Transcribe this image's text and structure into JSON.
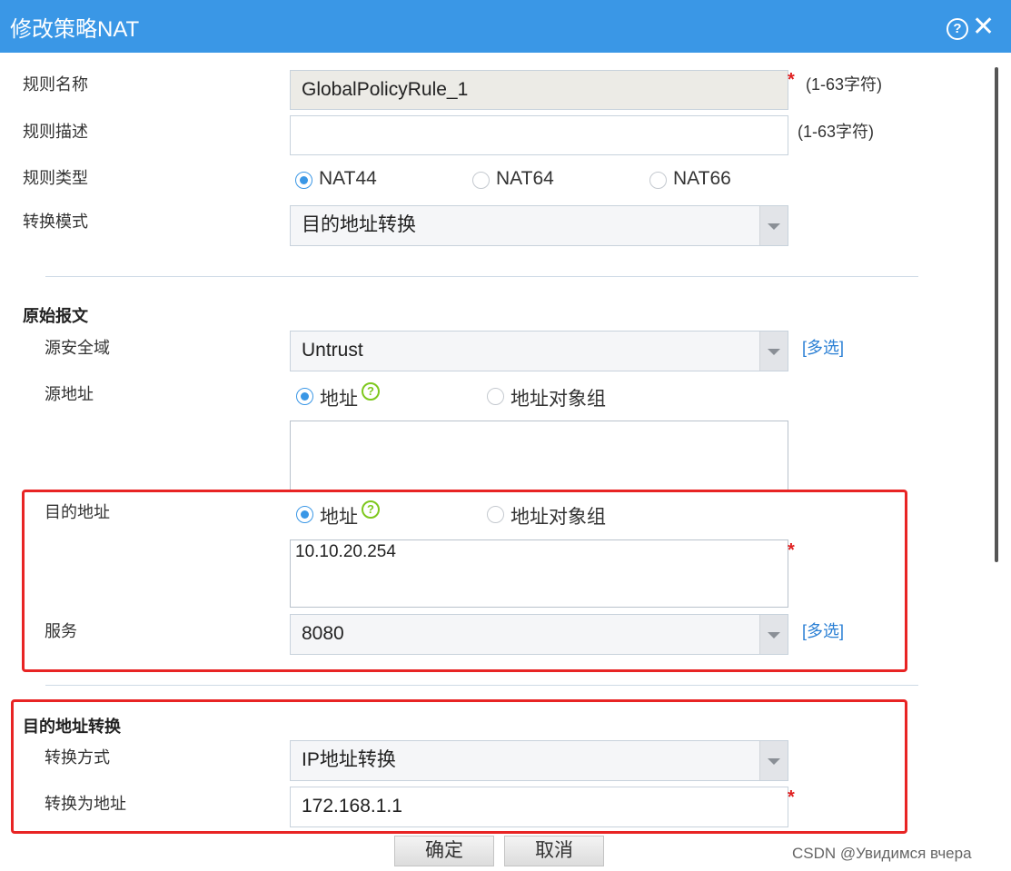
{
  "dialog": {
    "title": "修改策略NAT",
    "help_symbol": "?",
    "close_symbol": "✕"
  },
  "rule_name": {
    "label": "规则名称",
    "value": "GlobalPolicyRule_1",
    "required": "*",
    "hint": "(1-63字符)"
  },
  "rule_desc": {
    "label": "规则描述",
    "value": "",
    "hint": "(1-63字符)"
  },
  "rule_type": {
    "label": "规则类型",
    "options": [
      "NAT44",
      "NAT64",
      "NAT66"
    ],
    "selected": "NAT44"
  },
  "convert_mode": {
    "label": "转换模式",
    "value": "目的地址转换"
  },
  "original_packet": {
    "section_title": "原始报文",
    "src_zone": {
      "label": "源安全域",
      "value": "Untrust",
      "link": "[多选]"
    },
    "src_addr": {
      "label": "源地址",
      "option_addr": "地址",
      "option_group": "地址对象组",
      "value": ""
    },
    "dst_addr": {
      "label": "目的地址",
      "option_addr": "地址",
      "option_group": "地址对象组",
      "value": "10.10.20.254",
      "required": "*"
    },
    "service": {
      "label": "服务",
      "value": "8080",
      "link": "[多选]"
    }
  },
  "dst_translation": {
    "section_title": "目的地址转换",
    "method": {
      "label": "转换方式",
      "value": "IP地址转换"
    },
    "to_addr": {
      "label": "转换为地址",
      "value": "172.168.1.1",
      "required": "*"
    }
  },
  "buttons": {
    "ok": "确定",
    "cancel": "取消"
  },
  "watermark": "CSDN @Увидимся вчера",
  "colors": {
    "titlebar": "#3a97e6",
    "highlight_border": "#e82424",
    "link": "#2a7fd4",
    "required": "#e02020"
  }
}
